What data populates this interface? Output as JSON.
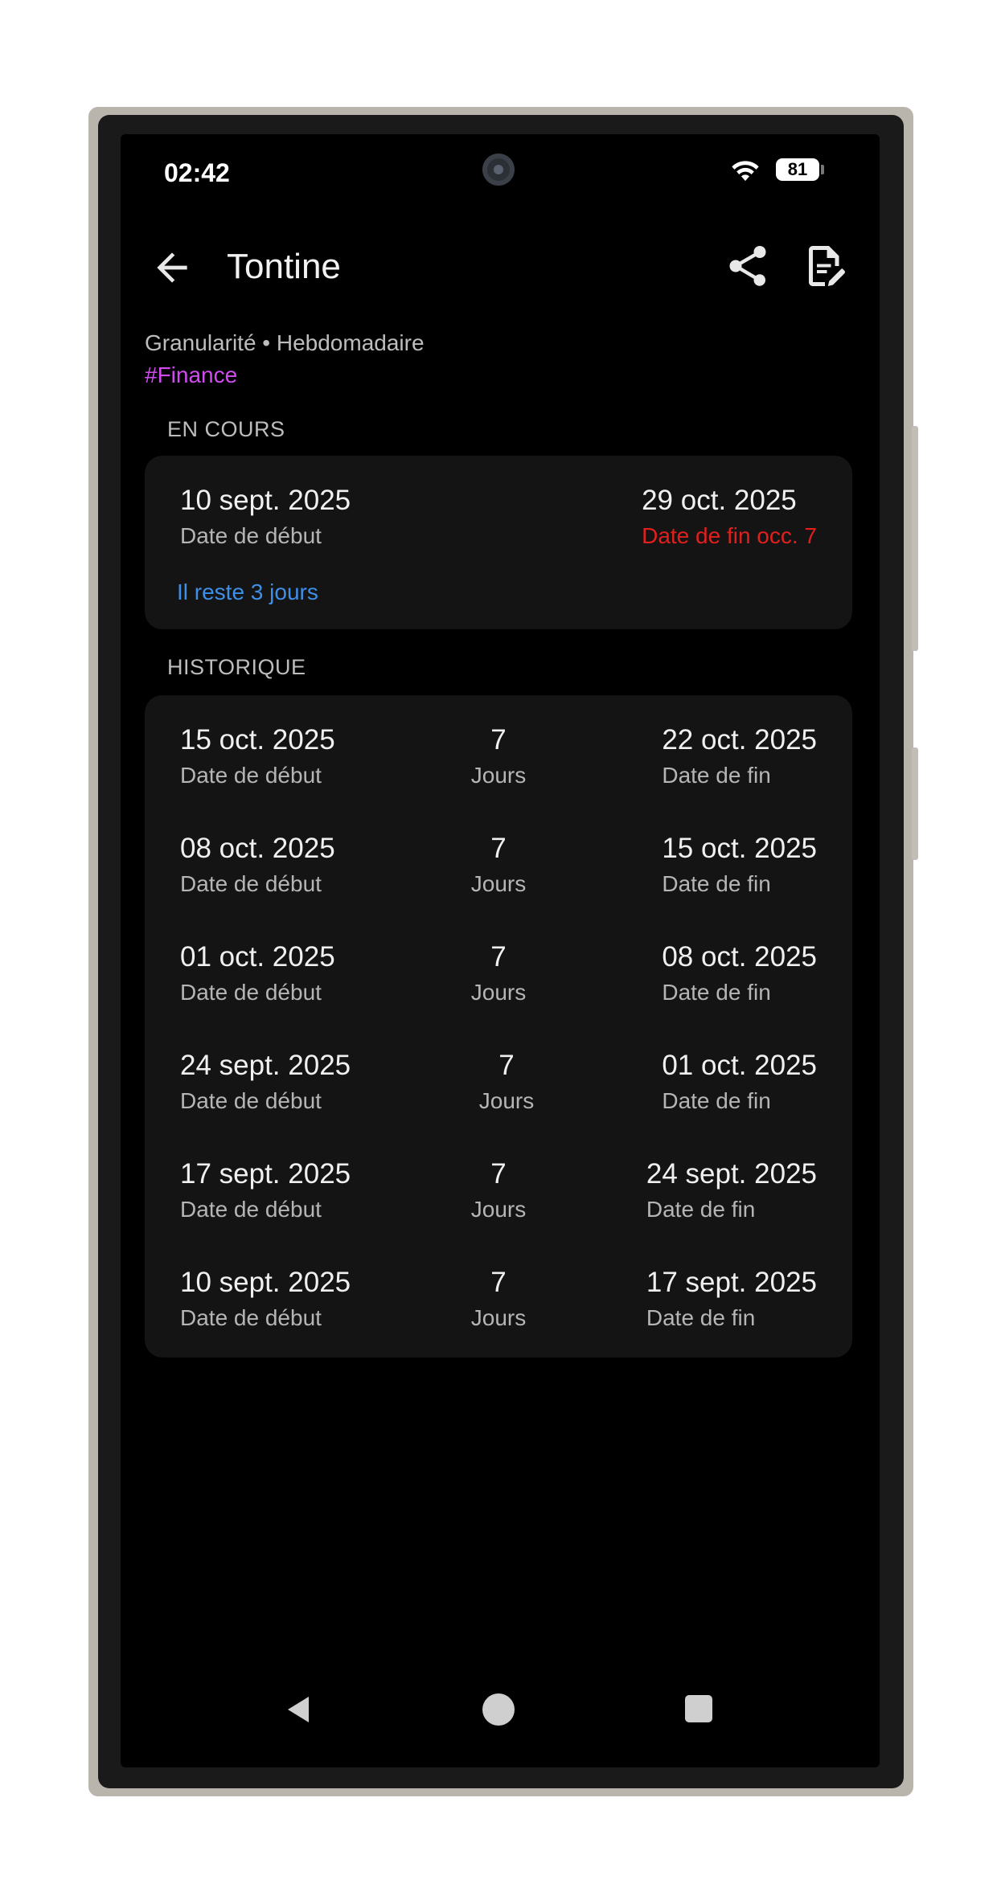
{
  "status_bar": {
    "time": "02:42",
    "battery": "81"
  },
  "header": {
    "title": "Tontine"
  },
  "meta": {
    "granularity": "Granularité • Hebdomadaire",
    "tag": "#Finance"
  },
  "current": {
    "section_label": "EN COURS",
    "start_value": "10 sept. 2025",
    "start_label": "Date de début",
    "end_value": "29 oct. 2025",
    "end_label": "Date de fin occ. 7",
    "remaining": "Il reste 3 jours"
  },
  "history": {
    "section_label": "HISTORIQUE",
    "rows": [
      {
        "start": "15 oct. 2025",
        "start_label": "Date de début",
        "days": "7",
        "days_label": "Jours",
        "end": "22 oct. 2025",
        "end_label": "Date de fin"
      },
      {
        "start": "08 oct. 2025",
        "start_label": "Date de début",
        "days": "7",
        "days_label": "Jours",
        "end": "15 oct. 2025",
        "end_label": "Date de fin"
      },
      {
        "start": "01 oct. 2025",
        "start_label": "Date de début",
        "days": "7",
        "days_label": "Jours",
        "end": "08 oct. 2025",
        "end_label": "Date de fin"
      },
      {
        "start": "24 sept. 2025",
        "start_label": "Date de début",
        "days": "7",
        "days_label": "Jours",
        "end": "01 oct. 2025",
        "end_label": "Date de fin"
      },
      {
        "start": "17 sept. 2025",
        "start_label": "Date de début",
        "days": "7",
        "days_label": "Jours",
        "end": "24 sept. 2025",
        "end_label": "Date de fin"
      },
      {
        "start": "10 sept. 2025",
        "start_label": "Date de début",
        "days": "7",
        "days_label": "Jours",
        "end": "17 sept. 2025",
        "end_label": "Date de fin"
      }
    ]
  },
  "icons": {
    "back": "arrow-left-icon",
    "share": "share-icon",
    "edit": "edit-note-icon",
    "wifi": "wifi-icon"
  },
  "colors": {
    "tag": "#d14cf0",
    "end_warning": "#e0201c",
    "remaining": "#3d8fe8",
    "card": "#141414"
  }
}
